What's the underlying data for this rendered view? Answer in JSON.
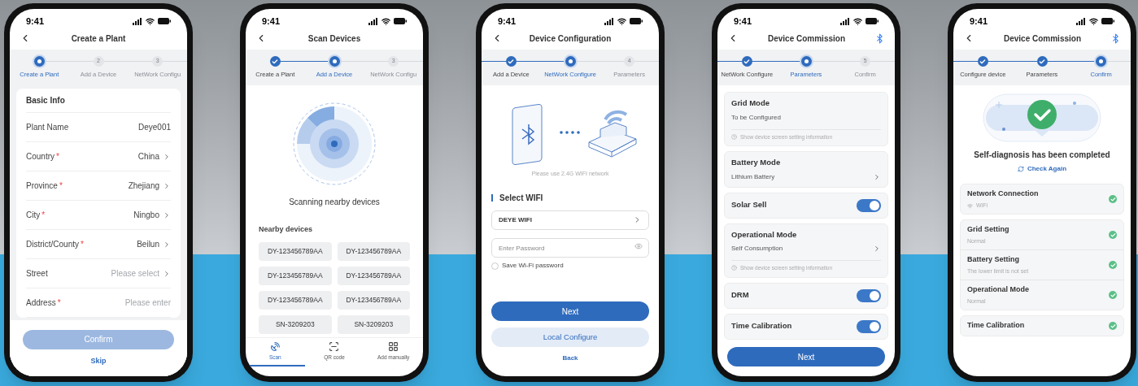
{
  "screens": [
    {
      "kind": "form",
      "time": "9:41",
      "title": "Create a Plant",
      "bluetooth": false,
      "continues_left": false,
      "steps": [
        {
          "label": "Create a Plant",
          "completed": false,
          "selected": true
        },
        {
          "number": "2",
          "label": "Add a Device",
          "completed": false,
          "selected": false
        },
        {
          "number": "3",
          "label": "NetWork Configu",
          "completed": false,
          "selected": false
        }
      ],
      "section": "Basic Info",
      "fields": [
        {
          "label": "Plant Name",
          "value": "Deye001",
          "chevron": false
        },
        {
          "label": "Country",
          "mark": "*",
          "value": "China",
          "chevron": true
        },
        {
          "label": "Province",
          "mark": "*",
          "value": "Zhejiang",
          "chevron": true
        },
        {
          "label": "City",
          "mark": "*",
          "value": "Ningbo",
          "chevron": true
        },
        {
          "label": "District/County",
          "mark": "*",
          "value": "Beilun",
          "chevron": true
        },
        {
          "label": "Street",
          "placeholder": "Please select",
          "chevron": true
        },
        {
          "label": "Address",
          "mark": "*",
          "placeholder": "Please enter",
          "chevron": false
        }
      ],
      "primary_button": {
        "label": "Confirm",
        "disabled": true
      },
      "link": "Skip"
    },
    {
      "kind": "scan",
      "time": "9:41",
      "title": "Scan Devices",
      "bluetooth": false,
      "continues_left": false,
      "steps": [
        {
          "label": "Create a Plant",
          "completed": true,
          "selected": false
        },
        {
          "label": "Add a Device",
          "completed": false,
          "selected": true
        },
        {
          "number": "3",
          "label": "NetWork Configu",
          "completed": false,
          "selected": false
        }
      ],
      "status": "Scanning nearby devices",
      "list_title": "Nearby devices",
      "devices": [
        "DY-123456789AA",
        "DY-123456789AA",
        "DY-123456789AA",
        "DY-123456789AA",
        "DY-123456789AA",
        "DY-123456789AA",
        "SN-3209203",
        "SN-3209203"
      ],
      "tabs": [
        {
          "label": "Scan",
          "selected": true
        },
        {
          "label": "QR code",
          "selected": false
        },
        {
          "label": "Add manually",
          "selected": false
        }
      ]
    },
    {
      "kind": "wifi",
      "time": "9:41",
      "title": "Device Configuration",
      "bluetooth": false,
      "continues_left": true,
      "steps": [
        {
          "label": "Add a Device",
          "completed": true,
          "selected": false
        },
        {
          "label": "NetWork Configure",
          "completed": false,
          "selected": true
        },
        {
          "number": "4",
          "label": "Parameters",
          "completed": false,
          "selected": false
        }
      ],
      "note": "Please use 2.4G WIFI network",
      "section": "Select WIFI",
      "network": "DEYE WIFI",
      "password_placeholder": "Enter Password",
      "remember": {
        "label": "Save Wi-Fi password",
        "checked": false
      },
      "primary_button": {
        "label": "Next",
        "disabled": false
      },
      "secondary_button": "Local Configure",
      "link": "Back"
    },
    {
      "kind": "params",
      "time": "9:41",
      "title": "Device Commission",
      "bluetooth": true,
      "continues_left": true,
      "steps": [
        {
          "label": "NetWork Configure",
          "completed": true,
          "selected": false
        },
        {
          "label": "Parameters",
          "completed": false,
          "selected": true
        },
        {
          "number": "5",
          "label": "Confirm",
          "completed": false,
          "selected": false
        }
      ],
      "cards": [
        {
          "kind": "select",
          "title": "Grid Mode",
          "value": "To be Configured",
          "chevron": false,
          "hint": "Show device screen setting information"
        },
        {
          "kind": "select",
          "title": "Battery Mode",
          "value": "Lithium Battery",
          "chevron": true
        },
        {
          "kind": "toggle",
          "title": "Solar Sell",
          "on": true
        },
        {
          "kind": "select",
          "title": "Operational Mode",
          "value": "Self Consumption",
          "chevron": true,
          "hint": "Show device screen setting information"
        },
        {
          "kind": "toggle",
          "title": "DRM",
          "on": true
        },
        {
          "kind": "toggle",
          "title": "Time Calibration",
          "on": true
        }
      ],
      "primary_button": {
        "label": "Next",
        "disabled": false
      }
    },
    {
      "kind": "diagnosis",
      "time": "9:41",
      "title": "Device Commission",
      "bluetooth": true,
      "continues_left": true,
      "steps": [
        {
          "label": "Configure device",
          "completed": true,
          "selected": false
        },
        {
          "label": "Parameters",
          "completed": true,
          "selected": false
        },
        {
          "label": "Confirm",
          "completed": false,
          "selected": true
        }
      ],
      "headline": "Self-diagnosis has been completed",
      "action": "Check Again",
      "groups": [
        [
          {
            "title": "Network Connection",
            "detail": "WiFi",
            "wifi": true,
            "passed": true
          }
        ],
        [
          {
            "title": "Grid Setting",
            "detail": "Normal",
            "wifi": false,
            "passed": true
          },
          {
            "title": "Battery Setting",
            "detail": "The lower limit is not set",
            "wifi": false,
            "passed": true
          },
          {
            "title": "Operational Mode",
            "detail": "Normal",
            "wifi": false,
            "passed": true
          }
        ],
        [
          {
            "title": "Time Calibration",
            "passed": true
          }
        ]
      ]
    }
  ]
}
